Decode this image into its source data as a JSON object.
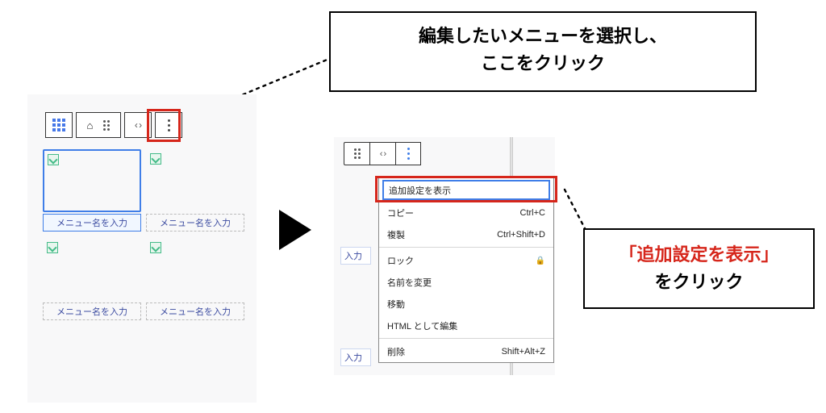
{
  "callout1": {
    "line1": "編集したいメニューを選択し、",
    "line2": "ここをクリック"
  },
  "callout2": {
    "line1": "「追加設定を表示」",
    "line2": "をクリック"
  },
  "panel1": {
    "placeholder": "メニュー名を入力",
    "cards": [
      {
        "caption": "メニュー名を入力",
        "selected": true
      },
      {
        "caption": "メニュー名を入力",
        "selected": false
      },
      {
        "caption": "メニュー名を入力",
        "selected": false
      },
      {
        "caption": "メニュー名を入力",
        "selected": false
      }
    ]
  },
  "panel2": {
    "stub_label": "入力",
    "menu": [
      {
        "label": "追加設定を表示",
        "shortcut": "",
        "selected": true
      },
      {
        "label": "コピー",
        "shortcut": "Ctrl+C"
      },
      {
        "label": "複製",
        "shortcut": "Ctrl+Shift+D"
      },
      {
        "sep": true
      },
      {
        "label": "ロック",
        "shortcut": "",
        "lock": true
      },
      {
        "label": "名前を変更",
        "shortcut": ""
      },
      {
        "label": "移動",
        "shortcut": ""
      },
      {
        "label": "HTML として編集",
        "shortcut": ""
      },
      {
        "sep": true
      },
      {
        "label": "削除",
        "shortcut": "Shift+Alt+Z"
      }
    ]
  },
  "colors": {
    "highlight": "#d6261b",
    "focus": "#3f7ee8"
  }
}
